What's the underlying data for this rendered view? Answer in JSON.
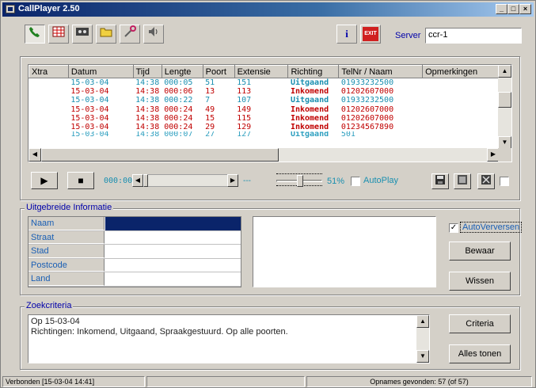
{
  "window": {
    "title": "CallPlayer 2.50",
    "minimize": "_",
    "maximize": "□",
    "close": "×"
  },
  "toolbar": {
    "buttons": [
      "phone-icon",
      "grid-icon",
      "tape-icon",
      "folder-icon",
      "tools-icon",
      "speaker-icon"
    ],
    "info_label": "i",
    "exit_label": "EXIT",
    "server_label": "Server",
    "server_value": "ccr-1"
  },
  "calls": {
    "headers": [
      "Xtra",
      "Datum",
      "Tijd",
      "Lengte",
      "Poort",
      "Extensie",
      "Richting",
      "TelNr / Naam",
      "Opmerkingen"
    ],
    "rows": [
      {
        "datum": "15-03-04",
        "tijd": "14:38",
        "lengte": "000:05",
        "poort": "51",
        "extensie": "151",
        "richting": "Uitgaand",
        "telnr": "01933232500",
        "dir": "out"
      },
      {
        "datum": "15-03-04",
        "tijd": "14:38",
        "lengte": "000:06",
        "poort": "13",
        "extensie": "113",
        "richting": "Inkomend",
        "telnr": "01202607000",
        "dir": "in"
      },
      {
        "datum": "15-03-04",
        "tijd": "14:38",
        "lengte": "000:22",
        "poort": "7",
        "extensie": "107",
        "richting": "Uitgaand",
        "telnr": "01933232500",
        "dir": "out"
      },
      {
        "datum": "15-03-04",
        "tijd": "14:38",
        "lengte": "000:24",
        "poort": "49",
        "extensie": "149",
        "richting": "Inkomend",
        "telnr": "01202607000",
        "dir": "in"
      },
      {
        "datum": "15-03-04",
        "tijd": "14:38",
        "lengte": "000:24",
        "poort": "15",
        "extensie": "115",
        "richting": "Inkomend",
        "telnr": "01202607000",
        "dir": "in"
      },
      {
        "datum": "15-03-04",
        "tijd": "14:38",
        "lengte": "000:24",
        "poort": "29",
        "extensie": "129",
        "richting": "Inkomend",
        "telnr": "01234567890",
        "dir": "in"
      },
      {
        "datum": "15-03-04",
        "tijd": "14:38",
        "lengte": "000:07",
        "poort": "27",
        "extensie": "127",
        "richting": "Uitgaand",
        "telnr": "501",
        "dir": "out"
      }
    ]
  },
  "player": {
    "play": "▶",
    "stop": "■",
    "time": "000:00",
    "position_fraction": 0,
    "dash": "---",
    "volume_text": "51%",
    "volume_fraction": 0.51,
    "autoplay_label": "AutoPlay",
    "autoplay_checked": false
  },
  "info": {
    "title": "Uitgebreide Informatie",
    "fields": [
      "Naam",
      "Straat",
      "Stad",
      "Postcode",
      "Land"
    ],
    "autorefresh_label": "AutoVerversen",
    "autorefresh_checked": true,
    "save_label": "Bewaar",
    "clear_label": "Wissen"
  },
  "criteria": {
    "title": "Zoekcriteria",
    "line1": "Op 15-03-04",
    "line2": "Richtingen: Inkomend, Uitgaand, Spraakgestuurd. Op alle poorten.",
    "criteria_button": "Criteria",
    "show_all_button": "Alles tonen"
  },
  "status": {
    "connected": "Verbonden [15-03-04 14:41]",
    "found": "Opnames gevonden: 57 (of 57)"
  },
  "colors": {
    "outgoing": "#1a8fb0",
    "incoming": "#c00000",
    "title": "#0a246a"
  }
}
